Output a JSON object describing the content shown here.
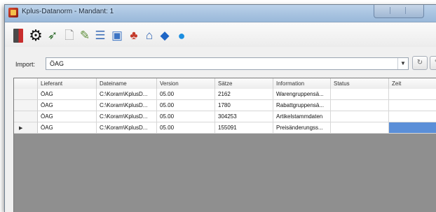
{
  "window": {
    "title": "Kplus-Datanorm - Mandant: 1"
  },
  "toolbar": {
    "icons": [
      {
        "name": "exit-icon"
      },
      {
        "name": "gear-icon",
        "glyph": "⚙"
      },
      {
        "name": "import-leaf-icon",
        "glyph": "➶"
      },
      {
        "name": "document-icon",
        "glyph": "🗋"
      },
      {
        "name": "edit-pen-icon",
        "glyph": "✎"
      },
      {
        "name": "list-icon",
        "glyph": "☰"
      },
      {
        "name": "box-icon",
        "glyph": "▣"
      },
      {
        "name": "people-icon",
        "glyph": "♣"
      },
      {
        "name": "house-icon",
        "glyph": "⌂"
      },
      {
        "name": "diamond-icon",
        "glyph": "◆"
      },
      {
        "name": "help-icon",
        "glyph": "●"
      }
    ]
  },
  "import": {
    "label": "Import:",
    "value": "ÖAG"
  },
  "grid": {
    "columns": [
      "Lieferant",
      "Dateiname",
      "Version",
      "Sätze",
      "Information",
      "Status",
      "Zeit"
    ],
    "rows": [
      [
        "ÖAG",
        "C:\\Koram\\KplusD...",
        "05.00",
        "2162",
        "Warengruppensä...",
        "",
        ""
      ],
      [
        "ÖAG",
        "C:\\Koram\\KplusD...",
        "05.00",
        "1780",
        "Rabattgruppensä...",
        "",
        ""
      ],
      [
        "ÖAG",
        "C:\\Koram\\KplusD...",
        "05.00",
        "304253",
        "Artikelstammdaten",
        "",
        ""
      ],
      [
        "ÖAG",
        "C:\\Koram\\KplusD...",
        "05.00",
        "155091",
        "Preisänderungss...",
        "",
        ""
      ]
    ],
    "current_row_marker": "▶"
  }
}
